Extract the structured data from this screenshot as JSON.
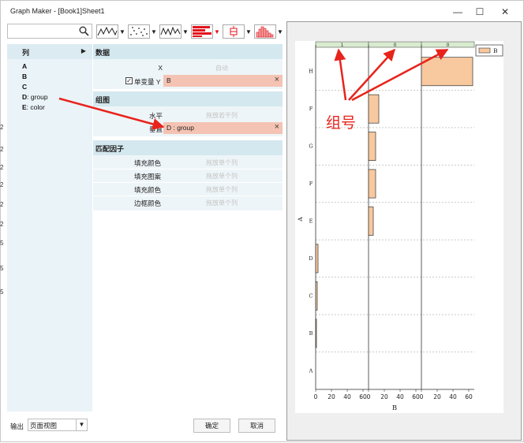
{
  "window": {
    "title": "Graph Maker - [Book1]Sheet1",
    "controls": {
      "minimize": "—",
      "maximize": "☐",
      "close": "✕"
    }
  },
  "toolbar": {
    "search": {
      "value": "",
      "placeholder": ""
    },
    "buttons": [
      "line-plot",
      "scatter-plot",
      "line-symbol-plot",
      "bar-plot",
      "box-plot",
      "histogram-plot"
    ]
  },
  "columns": {
    "header": "列",
    "items": [
      {
        "key": "A",
        "name": ""
      },
      {
        "key": "B",
        "name": ""
      },
      {
        "key": "C",
        "name": ""
      },
      {
        "key": "D",
        "name": ": group"
      },
      {
        "key": "E",
        "name": ": color"
      }
    ]
  },
  "data_section": {
    "header": "数据",
    "x_label": "X",
    "x_placeholder": "自动",
    "y_checkbox_label": "单变量 Y",
    "y_value": "B"
  },
  "group_section": {
    "header": "组图",
    "horizontal_label": "水平",
    "horizontal_placeholder": "拖放若干列",
    "vertical_label": "垂直",
    "vertical_value": "D : group"
  },
  "factor_section": {
    "header": "匹配因子",
    "rows": [
      {
        "label": "填充颜色",
        "placeholder": "拖放单个列"
      },
      {
        "label": "填充图案",
        "placeholder": "拖放单个列"
      },
      {
        "label": "填充颜色",
        "placeholder": "拖放单个列"
      },
      {
        "label": "边框颜色",
        "placeholder": "拖放单个列"
      }
    ]
  },
  "footer": {
    "output_label": "输出",
    "output_value": "页面视图",
    "ok": "确定",
    "cancel": "取消"
  },
  "annotation": {
    "text": "组号",
    "color": "#e8231c"
  },
  "background_numbers": [
    "2",
    "2",
    "2",
    "2",
    "2",
    "2",
    "5",
    "5",
    "5"
  ],
  "chart_data": {
    "type": "bar",
    "orientation": "horizontal",
    "panels": [
      {
        "label": "1",
        "values": [
          0,
          0,
          0,
          0,
          0,
          0,
          0,
          0
        ]
      },
      {
        "label": "0",
        "values": [
          0,
          0,
          0,
          0,
          0,
          0,
          0,
          0
        ]
      },
      {
        "label": "0",
        "values": [
          0,
          0,
          0,
          0,
          0,
          0,
          0,
          0
        ]
      }
    ],
    "categories": [
      "A",
      "B",
      "C",
      "D",
      "E",
      "F",
      "G",
      "F",
      "H"
    ],
    "values_by_panel": [
      [
        0,
        1,
        2,
        3,
        0,
        0,
        0,
        0,
        0
      ],
      [
        0,
        0,
        0,
        0,
        6,
        9,
        9,
        13,
        0
      ],
      [
        0,
        0,
        0,
        0,
        0,
        0,
        0,
        0,
        65
      ]
    ],
    "x_ticks": [
      "0",
      "20",
      "40",
      "60"
    ],
    "xlim": [
      0,
      65
    ],
    "xlabel": "B",
    "ylabel": "A",
    "legend": {
      "entries": [
        "B"
      ],
      "position": "top-right"
    },
    "bar_color": "#f8c89e",
    "bar_edge": "#333333",
    "grid": "dashed"
  }
}
